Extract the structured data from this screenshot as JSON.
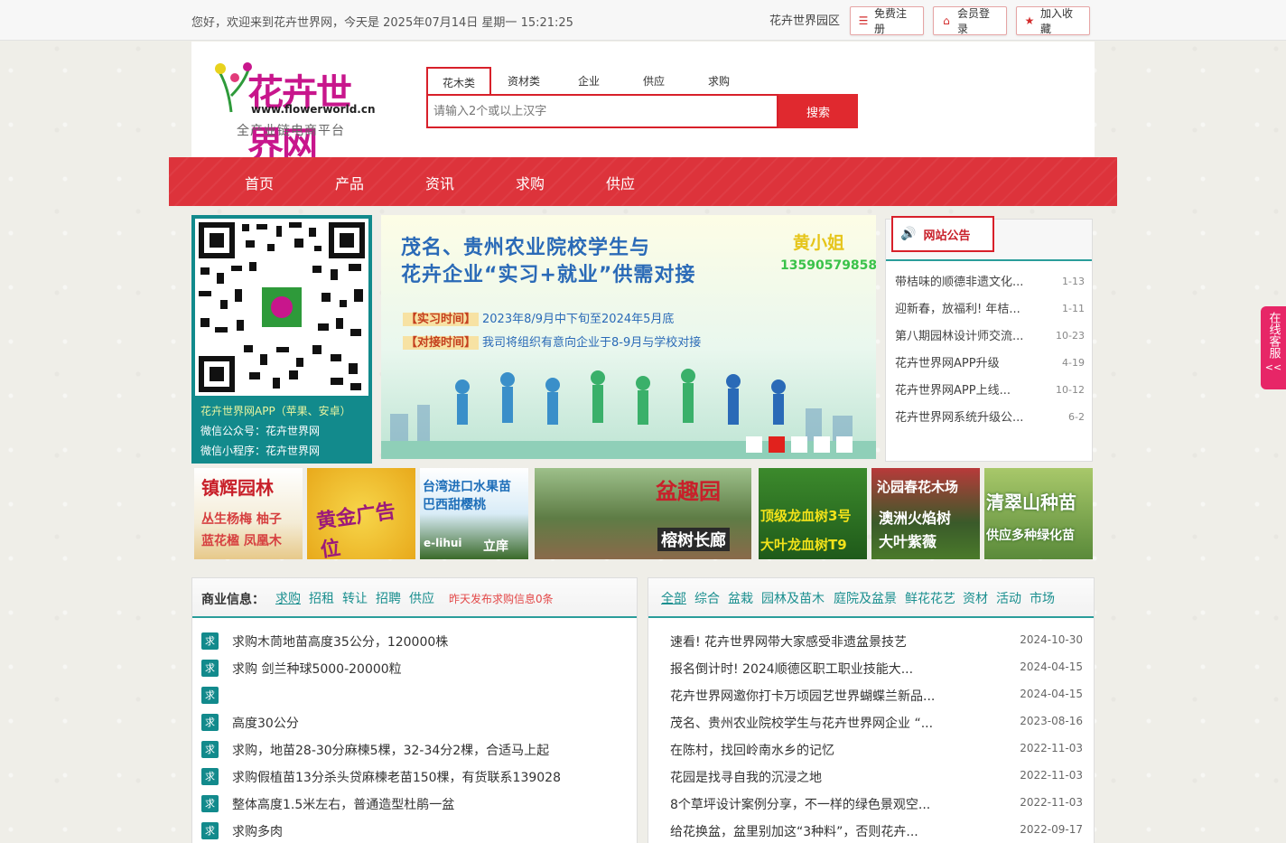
{
  "topbar": {
    "greeting": "您好，欢迎来到花卉世界网，今天是 2025年07月14日 星期一 15:21:25",
    "park": "花卉世界园区",
    "register": "免费注册",
    "login": "会员登录",
    "favorite": "加入收藏"
  },
  "logo": {
    "name": "花卉世界网",
    "url": "www.flowerworld.cn",
    "slogan": "全产业链电商平台"
  },
  "search": {
    "tabs": [
      "花木类",
      "资材类",
      "企业",
      "供应",
      "求购"
    ],
    "placeholder": "请输入2个或以上汉字",
    "button": "搜索"
  },
  "nav": [
    "首页",
    "产品",
    "资讯",
    "求购",
    "供应"
  ],
  "qr": {
    "lines": [
      "花卉世界网APP（苹果、安卓）",
      "微信公众号：花卉世界网",
      "微信小程序：花卉世界网"
    ]
  },
  "banner": {
    "headline1": "茂名、贵州农业院校学生与",
    "headline2": "花卉企业“实习+就业”供需对接",
    "contact_name": "黄小姐",
    "contact_phone": "13590579858",
    "tag1": "【实习时间】",
    "text1": "2023年8/9月中下旬至2024年5月底",
    "tag2": "【对接时间】",
    "text2": "我司将组织有意向企业于8-9月与学校对接"
  },
  "notice": {
    "title": "网站公告",
    "items": [
      {
        "t": "带桔味的顺德非遗文化...",
        "d": "1-13"
      },
      {
        "t": "迎新春，放福利! 年桔...",
        "d": "1-11"
      },
      {
        "t": "第八期园林设计师交流...",
        "d": "10-23"
      },
      {
        "t": "花卉世界网APP升级",
        "d": "4-19"
      },
      {
        "t": "花卉世界网APP上线...",
        "d": "10-12"
      },
      {
        "t": "花卉世界网系统升级公...",
        "d": "6-2"
      }
    ]
  },
  "ads": {
    "a1": [
      "镇辉园林",
      "丛生杨梅 柚子",
      "蓝花楹 凤凰木"
    ],
    "a2": [
      "黄金广告位"
    ],
    "a3": [
      "台湾进口水果苗",
      "巴西甜樱桃",
      "e-lihui",
      "立庠"
    ],
    "a4": [
      "盆趣园",
      "榕树长廊"
    ],
    "a5": [
      "顶级龙血树3号",
      "大叶龙血树T9"
    ],
    "a6": [
      "沁园春花木场",
      "澳洲火焰树",
      "大叶紫薇"
    ],
    "a7": [
      "清翠山种苗",
      "供应多种绿化苗"
    ]
  },
  "business": {
    "label": "商业信息：",
    "tabs": [
      "求购",
      "招租",
      "转让",
      "招聘",
      "供应"
    ],
    "note": "昨天发布求购信息0条",
    "badge": "求",
    "items": [
      "求购木茼地苗高度35公分，120000株",
      "求购 剑兰种球5000-20000粒",
      "",
      "高度30公分",
      "求购，地苗28-30分麻楝5棵，32-34分2棵，合适马上起",
      "求购假植苗13分杀头贷麻楝老苗150棵，有货联系139028",
      "整体高度1.5米左右，普通造型杜鹃一盆",
      "求购多肉"
    ]
  },
  "news": {
    "tabs": [
      "全部",
      "综合",
      "盆栽",
      "园林及苗木",
      "庭院及盆景",
      "鲜花花艺",
      "资材",
      "活动",
      "市场"
    ],
    "items": [
      {
        "t": "速看! 花卉世界网带大家感受非遗盆景技艺",
        "d": "2024-10-30"
      },
      {
        "t": "报名倒计时! 2024顺德区职工职业技能大...",
        "d": "2024-04-15"
      },
      {
        "t": "花卉世界网邀你打卡万顷园艺世界蝴蝶兰新品...",
        "d": "2024-04-15"
      },
      {
        "t": "茂名、贵州农业院校学生与花卉世界网企业 “...",
        "d": "2023-08-16"
      },
      {
        "t": "在陈村，找回岭南水乡的记忆",
        "d": "2022-11-03"
      },
      {
        "t": "花园是找寻自我的沉浸之地",
        "d": "2022-11-03"
      },
      {
        "t": "8个草坪设计案例分享，不一样的绿色景观空...",
        "d": "2022-11-03"
      },
      {
        "t": "给花换盆，盆里别加这“3种料”，否则花卉...",
        "d": "2022-09-17"
      }
    ]
  },
  "service": {
    "label": "在线客服",
    "arrow": "<<"
  }
}
